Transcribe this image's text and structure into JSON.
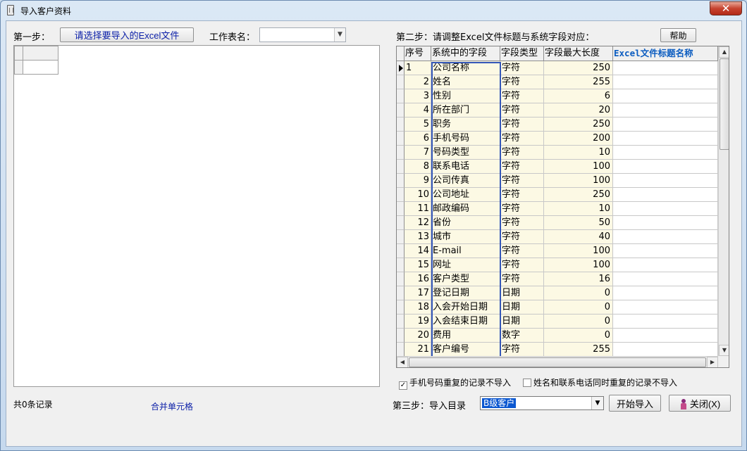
{
  "window": {
    "title": "导入客户资料",
    "close_symbol": "✕"
  },
  "step1": {
    "label": "第一步：",
    "choose_excel_button": "请选择要导入的Excel文件",
    "sheet_label": "工作表名：",
    "sheet_value": ""
  },
  "step2": {
    "label": "第二步：请调整Excel文件标题与系统字段对应：",
    "help_button": "帮助"
  },
  "grid": {
    "headers": [
      "序号",
      "系统中的字段",
      "字段类型",
      "字段最大长度",
      "Excel文件标题名称"
    ],
    "rows": [
      {
        "seq": "1",
        "field": "公司名称",
        "type": "字符",
        "len": "250",
        "excel": ""
      },
      {
        "seq": "2",
        "field": "姓名",
        "type": "字符",
        "len": "255",
        "excel": ""
      },
      {
        "seq": "3",
        "field": "性别",
        "type": "字符",
        "len": "6",
        "excel": ""
      },
      {
        "seq": "4",
        "field": "所在部门",
        "type": "字符",
        "len": "20",
        "excel": ""
      },
      {
        "seq": "5",
        "field": "职务",
        "type": "字符",
        "len": "250",
        "excel": ""
      },
      {
        "seq": "6",
        "field": "手机号码",
        "type": "字符",
        "len": "200",
        "excel": ""
      },
      {
        "seq": "7",
        "field": "号码类型",
        "type": "字符",
        "len": "10",
        "excel": ""
      },
      {
        "seq": "8",
        "field": "联系电话",
        "type": "字符",
        "len": "100",
        "excel": ""
      },
      {
        "seq": "9",
        "field": "公司传真",
        "type": "字符",
        "len": "100",
        "excel": ""
      },
      {
        "seq": "10",
        "field": "公司地址",
        "type": "字符",
        "len": "250",
        "excel": ""
      },
      {
        "seq": "11",
        "field": "邮政编码",
        "type": "字符",
        "len": "10",
        "excel": ""
      },
      {
        "seq": "12",
        "field": "省份",
        "type": "字符",
        "len": "50",
        "excel": ""
      },
      {
        "seq": "13",
        "field": "城市",
        "type": "字符",
        "len": "40",
        "excel": ""
      },
      {
        "seq": "14",
        "field": "E-mail",
        "type": "字符",
        "len": "100",
        "excel": ""
      },
      {
        "seq": "15",
        "field": "网址",
        "type": "字符",
        "len": "100",
        "excel": ""
      },
      {
        "seq": "16",
        "field": "客户类型",
        "type": "字符",
        "len": "16",
        "excel": ""
      },
      {
        "seq": "17",
        "field": "登记日期",
        "type": "日期",
        "len": "0",
        "excel": ""
      },
      {
        "seq": "18",
        "field": "入会开始日期",
        "type": "日期",
        "len": "0",
        "excel": ""
      },
      {
        "seq": "19",
        "field": "入会结束日期",
        "type": "日期",
        "len": "0",
        "excel": ""
      },
      {
        "seq": "20",
        "field": "费用",
        "type": "数字",
        "len": "0",
        "excel": ""
      },
      {
        "seq": "21",
        "field": "客户编号",
        "type": "字符",
        "len": "255",
        "excel": ""
      }
    ]
  },
  "options": {
    "skip_duplicate_mobile": {
      "label": "手机号码重复的记录不导入",
      "checked": true
    },
    "skip_duplicate_name_phone": {
      "label": "姓名和联系电话同时重复的记录不导入",
      "checked": false
    }
  },
  "footer": {
    "record_count": "共0条记录",
    "merge_cells_link": "合并单元格"
  },
  "step3": {
    "label": "第三步：导入目录",
    "directory_value": "B级客户",
    "start_import_button": "开始导入",
    "close_button": "关闭(X)"
  }
}
